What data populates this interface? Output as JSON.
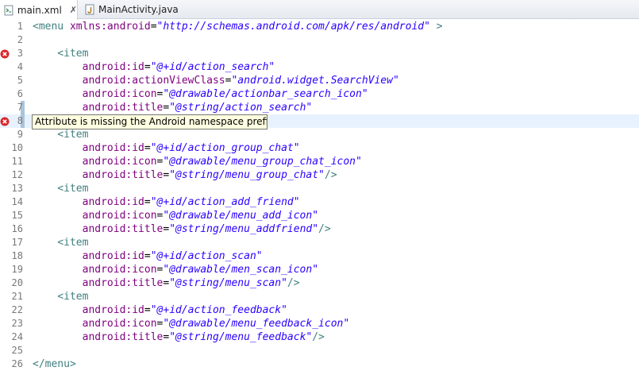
{
  "tabs": [
    {
      "label": "main.xml",
      "close": "✗",
      "icon": "xml-file-icon",
      "active": true
    },
    {
      "label": "MainActivity.java",
      "icon": "java-file-icon",
      "active": false
    }
  ],
  "tooltip": {
    "text": "Attribute is missing the Android namespace prefix"
  },
  "colors": {
    "tag": "#3f7f7f",
    "attribute": "#7f007f",
    "value": "#2a00ff",
    "error": "#d9272b",
    "tooltip_bg": "#ffffe1",
    "current_line": "#e8f2fe"
  },
  "lines": [
    {
      "num": "1",
      "parts": [
        [
          "tag",
          "<menu "
        ],
        [
          "attr",
          "xmlns:android"
        ],
        [
          "plain",
          "="
        ],
        [
          "val",
          "\"http://schemas.android.com/apk/res/android\""
        ],
        [
          "tag",
          " >"
        ]
      ]
    },
    {
      "num": "2",
      "parts": []
    },
    {
      "num": "3",
      "error": true,
      "parts": [
        [
          "tag",
          "    <item"
        ]
      ]
    },
    {
      "num": "4",
      "parts": [
        [
          "attr",
          "        android:id"
        ],
        [
          "plain",
          "="
        ],
        [
          "val",
          "\"@+id/action_search\""
        ]
      ]
    },
    {
      "num": "5",
      "parts": [
        [
          "attr",
          "        android:actionViewClass"
        ],
        [
          "plain",
          "="
        ],
        [
          "val",
          "\"android.widget.SearchView\""
        ]
      ]
    },
    {
      "num": "6",
      "parts": [
        [
          "attr",
          "        android:icon"
        ],
        [
          "plain",
          "="
        ],
        [
          "val",
          "\"@drawable/actionbar_search_icon\""
        ]
      ]
    },
    {
      "num": "7",
      "change": true,
      "parts": [
        [
          "attr",
          "        android:title"
        ],
        [
          "plain",
          "="
        ],
        [
          "val",
          "\"@string/action_search\""
        ]
      ]
    },
    {
      "num": "8",
      "error": true,
      "change": true,
      "current": true,
      "parts": []
    },
    {
      "num": "9",
      "parts": [
        [
          "tag",
          "    <item"
        ]
      ]
    },
    {
      "num": "10",
      "parts": [
        [
          "attr",
          "        android:id"
        ],
        [
          "plain",
          "="
        ],
        [
          "val",
          "\"@+id/action_group_chat\""
        ]
      ]
    },
    {
      "num": "11",
      "parts": [
        [
          "attr",
          "        android:icon"
        ],
        [
          "plain",
          "="
        ],
        [
          "val",
          "\"@drawable/menu_group_chat_icon\""
        ]
      ]
    },
    {
      "num": "12",
      "parts": [
        [
          "attr",
          "        android:title"
        ],
        [
          "plain",
          "="
        ],
        [
          "val",
          "\"@string/menu_group_chat\""
        ],
        [
          "tag",
          "/>"
        ]
      ]
    },
    {
      "num": "13",
      "parts": [
        [
          "tag",
          "    <item"
        ]
      ]
    },
    {
      "num": "14",
      "parts": [
        [
          "attr",
          "        android:id"
        ],
        [
          "plain",
          "="
        ],
        [
          "val",
          "\"@+id/action_add_friend\""
        ]
      ]
    },
    {
      "num": "15",
      "parts": [
        [
          "attr",
          "        android:icon"
        ],
        [
          "plain",
          "="
        ],
        [
          "val",
          "\"@drawable/menu_add_icon\""
        ]
      ]
    },
    {
      "num": "16",
      "parts": [
        [
          "attr",
          "        android:title"
        ],
        [
          "plain",
          "="
        ],
        [
          "val",
          "\"@string/menu_addfriend\""
        ],
        [
          "tag",
          "/>"
        ]
      ]
    },
    {
      "num": "17",
      "parts": [
        [
          "tag",
          "    <item"
        ]
      ]
    },
    {
      "num": "18",
      "parts": [
        [
          "attr",
          "        android:id"
        ],
        [
          "plain",
          "="
        ],
        [
          "val",
          "\"@+id/action_scan\""
        ]
      ]
    },
    {
      "num": "19",
      "parts": [
        [
          "attr",
          "        android:icon"
        ],
        [
          "plain",
          "="
        ],
        [
          "val",
          "\"@drawable/men_scan_icon\""
        ]
      ]
    },
    {
      "num": "20",
      "parts": [
        [
          "attr",
          "        android:title"
        ],
        [
          "plain",
          "="
        ],
        [
          "val",
          "\"@string/menu_scan\""
        ],
        [
          "tag",
          "/>"
        ]
      ]
    },
    {
      "num": "21",
      "parts": [
        [
          "tag",
          "    <item"
        ]
      ]
    },
    {
      "num": "22",
      "parts": [
        [
          "attr",
          "        android:id"
        ],
        [
          "plain",
          "="
        ],
        [
          "val",
          "\"@+id/action_feedback\""
        ]
      ]
    },
    {
      "num": "23",
      "parts": [
        [
          "attr",
          "        android:icon"
        ],
        [
          "plain",
          "="
        ],
        [
          "val",
          "\"@drawable/menu_feedback_icon\""
        ]
      ]
    },
    {
      "num": "24",
      "parts": [
        [
          "attr",
          "        android:title"
        ],
        [
          "plain",
          "="
        ],
        [
          "val",
          "\"@string/menu_feedback\""
        ],
        [
          "tag",
          "/>"
        ]
      ]
    },
    {
      "num": "25",
      "parts": []
    },
    {
      "num": "26",
      "parts": [
        [
          "tag",
          "</menu>"
        ]
      ]
    }
  ]
}
